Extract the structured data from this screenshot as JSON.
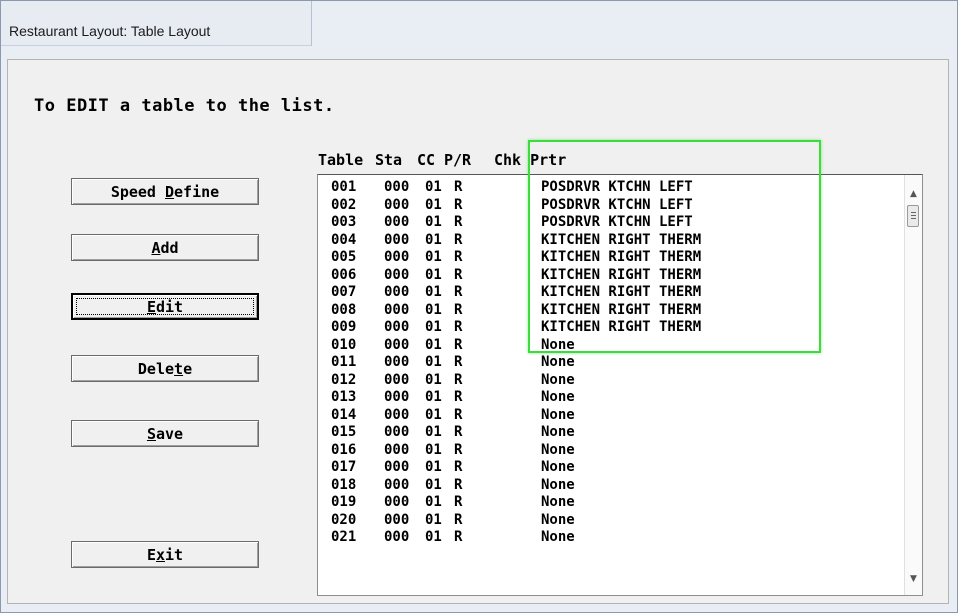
{
  "window": {
    "title": "Restaurant Layout: Table Layout"
  },
  "instruction": "To EDIT a table to the list.",
  "buttons": {
    "speed_define": {
      "pre": "Speed ",
      "key": "D",
      "post": "efine"
    },
    "add": {
      "pre": "",
      "key": "A",
      "post": "dd"
    },
    "edit": {
      "pre": "",
      "key": "E",
      "post": "dit"
    },
    "delete": {
      "pre": "Dele",
      "key": "t",
      "post": "e"
    },
    "save": {
      "pre": "",
      "key": "S",
      "post": "ave"
    },
    "exit": {
      "pre": "E",
      "key": "x",
      "post": "it"
    }
  },
  "columns": {
    "table": "Table",
    "sta": "Sta",
    "cc": "CC",
    "pr": "P/R",
    "chk_prtr": "Chk Prtr"
  },
  "rows": [
    {
      "table": "001",
      "sta": "000",
      "cc": "01",
      "pr": "R",
      "chk_prtr": "POSDRVR KTCHN LEFT"
    },
    {
      "table": "002",
      "sta": "000",
      "cc": "01",
      "pr": "R",
      "chk_prtr": "POSDRVR KTCHN LEFT"
    },
    {
      "table": "003",
      "sta": "000",
      "cc": "01",
      "pr": "R",
      "chk_prtr": "POSDRVR KTCHN LEFT"
    },
    {
      "table": "004",
      "sta": "000",
      "cc": "01",
      "pr": "R",
      "chk_prtr": "KITCHEN RIGHT THERM"
    },
    {
      "table": "005",
      "sta": "000",
      "cc": "01",
      "pr": "R",
      "chk_prtr": "KITCHEN RIGHT THERM"
    },
    {
      "table": "006",
      "sta": "000",
      "cc": "01",
      "pr": "R",
      "chk_prtr": "KITCHEN RIGHT THERM"
    },
    {
      "table": "007",
      "sta": "000",
      "cc": "01",
      "pr": "R",
      "chk_prtr": "KITCHEN RIGHT THERM"
    },
    {
      "table": "008",
      "sta": "000",
      "cc": "01",
      "pr": "R",
      "chk_prtr": "KITCHEN RIGHT THERM"
    },
    {
      "table": "009",
      "sta": "000",
      "cc": "01",
      "pr": "R",
      "chk_prtr": "KITCHEN RIGHT THERM"
    },
    {
      "table": "010",
      "sta": "000",
      "cc": "01",
      "pr": "R",
      "chk_prtr": "None"
    },
    {
      "table": "011",
      "sta": "000",
      "cc": "01",
      "pr": "R",
      "chk_prtr": "None"
    },
    {
      "table": "012",
      "sta": "000",
      "cc": "01",
      "pr": "R",
      "chk_prtr": "None"
    },
    {
      "table": "013",
      "sta": "000",
      "cc": "01",
      "pr": "R",
      "chk_prtr": "None"
    },
    {
      "table": "014",
      "sta": "000",
      "cc": "01",
      "pr": "R",
      "chk_prtr": "None"
    },
    {
      "table": "015",
      "sta": "000",
      "cc": "01",
      "pr": "R",
      "chk_prtr": "None"
    },
    {
      "table": "016",
      "sta": "000",
      "cc": "01",
      "pr": "R",
      "chk_prtr": "None"
    },
    {
      "table": "017",
      "sta": "000",
      "cc": "01",
      "pr": "R",
      "chk_prtr": "None"
    },
    {
      "table": "018",
      "sta": "000",
      "cc": "01",
      "pr": "R",
      "chk_prtr": "None"
    },
    {
      "table": "019",
      "sta": "000",
      "cc": "01",
      "pr": "R",
      "chk_prtr": "None"
    },
    {
      "table": "020",
      "sta": "000",
      "cc": "01",
      "pr": "R",
      "chk_prtr": "None"
    },
    {
      "table": "021",
      "sta": "000",
      "cc": "01",
      "pr": "R",
      "chk_prtr": "None"
    }
  ],
  "scrollbar": {
    "up_icon": "▲",
    "down_icon": "▼"
  },
  "colors": {
    "highlight": "#3ddc3d",
    "window_bg": "#f0f0f0"
  }
}
